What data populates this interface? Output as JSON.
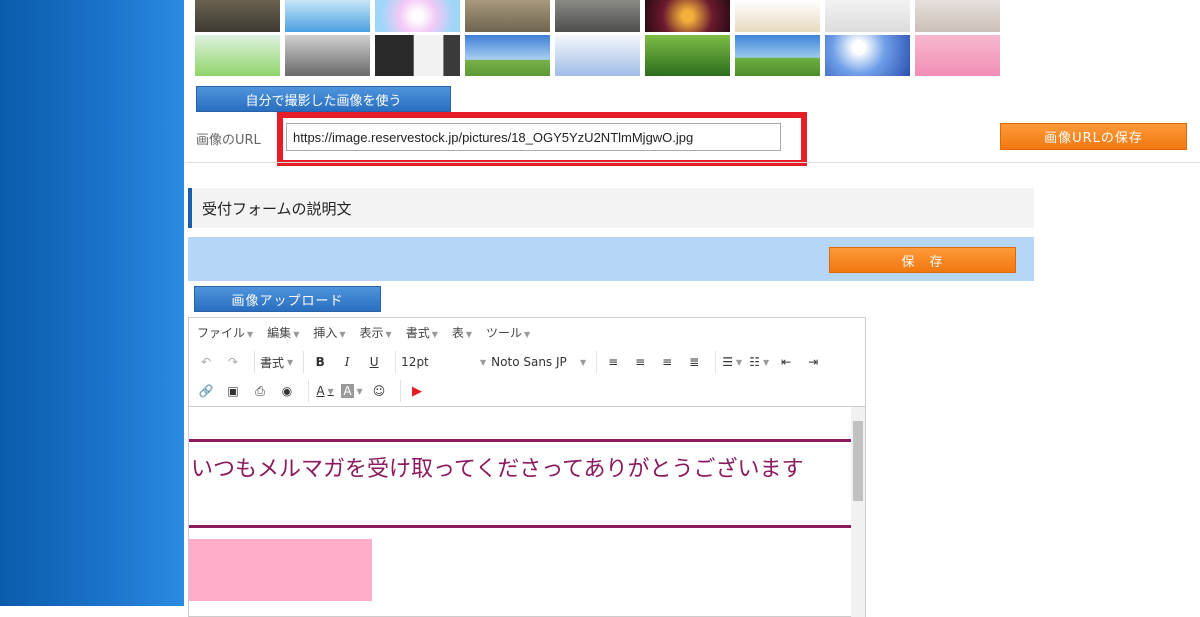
{
  "upload_own_button": "自分で撮影した画像を使う",
  "url_label": "画像のURL",
  "url_value": "https://image.reservestock.jp/pictures/18_OGY5YzU2NTlmMjgwO.jpg",
  "save_url_button": "画像URLの保存",
  "section_title": "受付フォームの説明文",
  "save_button": "保　存",
  "image_upload_button": "画像アップロード",
  "editor": {
    "menus": [
      "ファイル",
      "編集",
      "挿入",
      "表示",
      "書式",
      "表",
      "ツール"
    ],
    "format_label": "書式",
    "font_size": "12pt",
    "font_family": "Noto Sans JP",
    "headline": "いつもメルマガを受け取ってくださってありがとうございます"
  },
  "colors": {
    "accent_orange": "#f07810",
    "accent_blue": "#2a6fc0",
    "headline": "#8b1a5e",
    "highlight_red": "#e61d24"
  }
}
